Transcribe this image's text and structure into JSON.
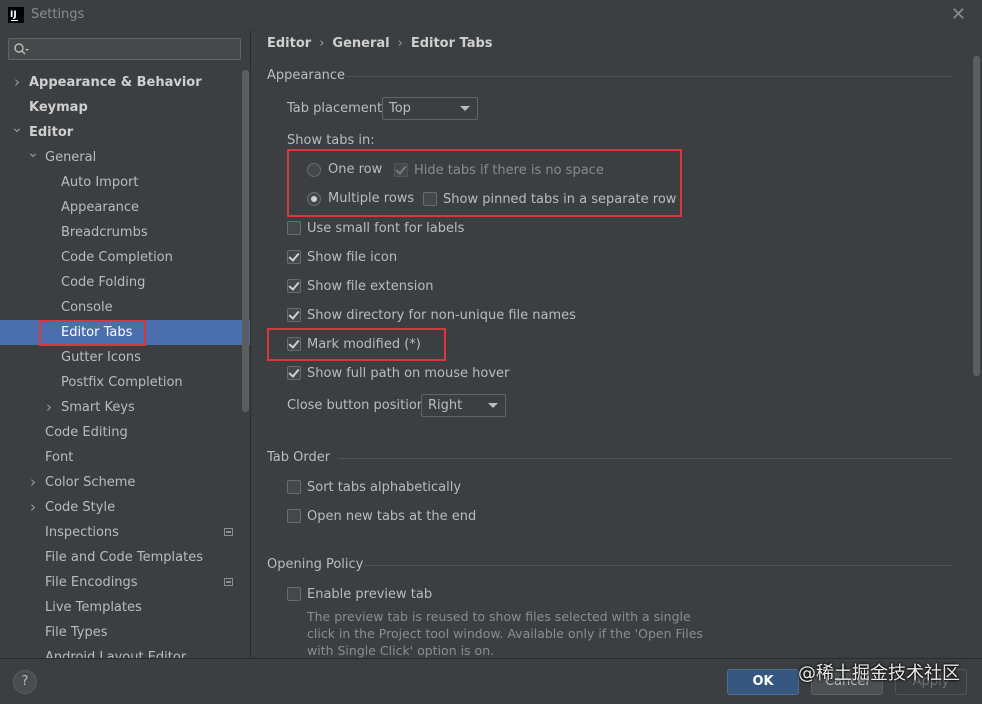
{
  "window": {
    "title": "Settings"
  },
  "search": {
    "placeholder": ""
  },
  "breadcrumb": [
    "Editor",
    "General",
    "Editor Tabs"
  ],
  "sidebar": {
    "items": [
      {
        "label": "Appearance & Behavior",
        "level": 0,
        "expander": "collapsed",
        "bold": true
      },
      {
        "label": "Keymap",
        "level": 0,
        "expander": "none",
        "bold": true
      },
      {
        "label": "Editor",
        "level": 0,
        "expander": "expanded",
        "bold": true
      },
      {
        "label": "General",
        "level": 1,
        "expander": "expanded"
      },
      {
        "label": "Auto Import",
        "level": 2
      },
      {
        "label": "Appearance",
        "level": 2
      },
      {
        "label": "Breadcrumbs",
        "level": 2
      },
      {
        "label": "Code Completion",
        "level": 2
      },
      {
        "label": "Code Folding",
        "level": 2
      },
      {
        "label": "Console",
        "level": 2
      },
      {
        "label": "Editor Tabs",
        "level": 2,
        "selected": true
      },
      {
        "label": "Gutter Icons",
        "level": 2
      },
      {
        "label": "Postfix Completion",
        "level": 2
      },
      {
        "label": "Smart Keys",
        "level": 2,
        "expander": "collapsed"
      },
      {
        "label": "Code Editing",
        "level": 1
      },
      {
        "label": "Font",
        "level": 1
      },
      {
        "label": "Color Scheme",
        "level": 1,
        "expander": "collapsed"
      },
      {
        "label": "Code Style",
        "level": 1,
        "expander": "collapsed"
      },
      {
        "label": "Inspections",
        "level": 1,
        "badge": true
      },
      {
        "label": "File and Code Templates",
        "level": 1
      },
      {
        "label": "File Encodings",
        "level": 1,
        "badge": true
      },
      {
        "label": "Live Templates",
        "level": 1
      },
      {
        "label": "File Types",
        "level": 1
      },
      {
        "label": "Android Layout Editor",
        "level": 1
      }
    ]
  },
  "appearance": {
    "title": "Appearance",
    "tab_placement_label": "Tab placement:",
    "tab_placement_value": "Top",
    "show_tabs_in_label": "Show tabs in:",
    "one_row_label": "One row",
    "hide_tabs_label": "Hide tabs if there is no space",
    "multiple_rows_label": "Multiple rows",
    "pinned_tabs_label": "Show pinned tabs in a separate row",
    "small_font_label": "Use small font for labels",
    "file_icon_label": "Show file icon",
    "file_extension_label": "Show file extension",
    "directory_label": "Show directory for non-unique file names",
    "mark_modified_label": "Mark modified (*)",
    "full_path_label": "Show full path on mouse hover",
    "close_button_label": "Close button position:",
    "close_button_value": "Right"
  },
  "tab_order": {
    "title": "Tab Order",
    "sort_label": "Sort tabs alphabetically",
    "open_end_label": "Open new tabs at the end"
  },
  "opening_policy": {
    "title": "Opening Policy",
    "preview_label": "Enable preview tab",
    "preview_help": "The preview tab is reused to show files selected with a single click in the Project tool window. Available only if the 'Open Files with Single Click' option is on."
  },
  "buttons": {
    "help": "?",
    "ok": "OK",
    "cancel": "Cancel",
    "apply": "Apply"
  },
  "watermark": "@稀土掘金技术社区",
  "colors": {
    "selection": "#4b6eaf",
    "highlight_box": "#d9363e",
    "ok_button": "#365880"
  }
}
